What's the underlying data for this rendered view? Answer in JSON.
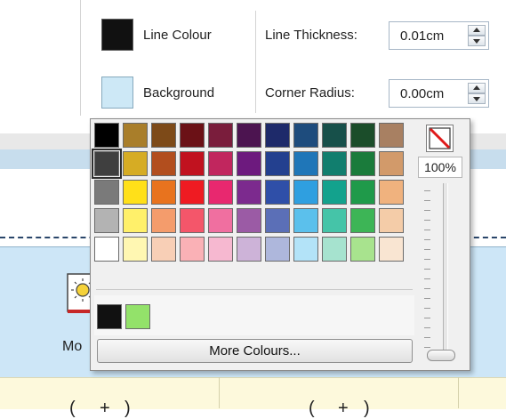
{
  "ribbon": {
    "line_colour_label": "Line Colour",
    "background_label": "Background",
    "line_colour_value": "#111111",
    "background_value": "#cde8f6",
    "line_thickness": {
      "label": "Line Thickness:",
      "value": "0.01cm"
    },
    "corner_radius": {
      "label": "Corner Radius:",
      "value": "0.00cm"
    }
  },
  "behind": {
    "item_label": "Mo",
    "table_peek": [
      "(",
      "+",
      ")",
      "(",
      "+",
      ")"
    ]
  },
  "popup": {
    "palette_rows": [
      [
        "#000000",
        "#a97e2a",
        "#7d4a18",
        "#6b1116",
        "#7a1d3c",
        "#4c1450",
        "#1e2a6a",
        "#1e4c7d",
        "#17504a",
        "#1b4d2a",
        "#a88062"
      ],
      [
        "#3f3f3f",
        "#d6ac24",
        "#b24e1e",
        "#c1121f",
        "#c1265e",
        "#6d1a7e",
        "#23408f",
        "#1f76b8",
        "#117e6e",
        "#1a7b3b",
        "#d29a6a"
      ],
      [
        "#7a7a7a",
        "#ffe019",
        "#e8731e",
        "#ef1b22",
        "#e8286f",
        "#7c2a8e",
        "#2f4fa8",
        "#2f9fe0",
        "#13a28d",
        "#1f9a4a",
        "#f0b27e"
      ],
      [
        "#b3b3b3",
        "#fff06a",
        "#f49c6c",
        "#f4566a",
        "#f06fa0",
        "#9b5ba5",
        "#5b6fb7",
        "#5bc0ec",
        "#45c4a8",
        "#3db556",
        "#f4cca8"
      ],
      [
        "#ffffff",
        "#fff7b2",
        "#f8cfb6",
        "#fab1b6",
        "#f6b8d0",
        "#cdb3d8",
        "#aeb7dc",
        "#b3e3f8",
        "#a6e3cf",
        "#a8e38e",
        "#f9e5d2"
      ]
    ],
    "selected_cell": "row2-col1",
    "recent_colours": [
      "#111111",
      "#93e26a"
    ],
    "more_colours_label": "More Colours...",
    "no_colour_icon": "no-colour-icon",
    "opacity_value": "100%",
    "opacity_level": 1.0
  }
}
